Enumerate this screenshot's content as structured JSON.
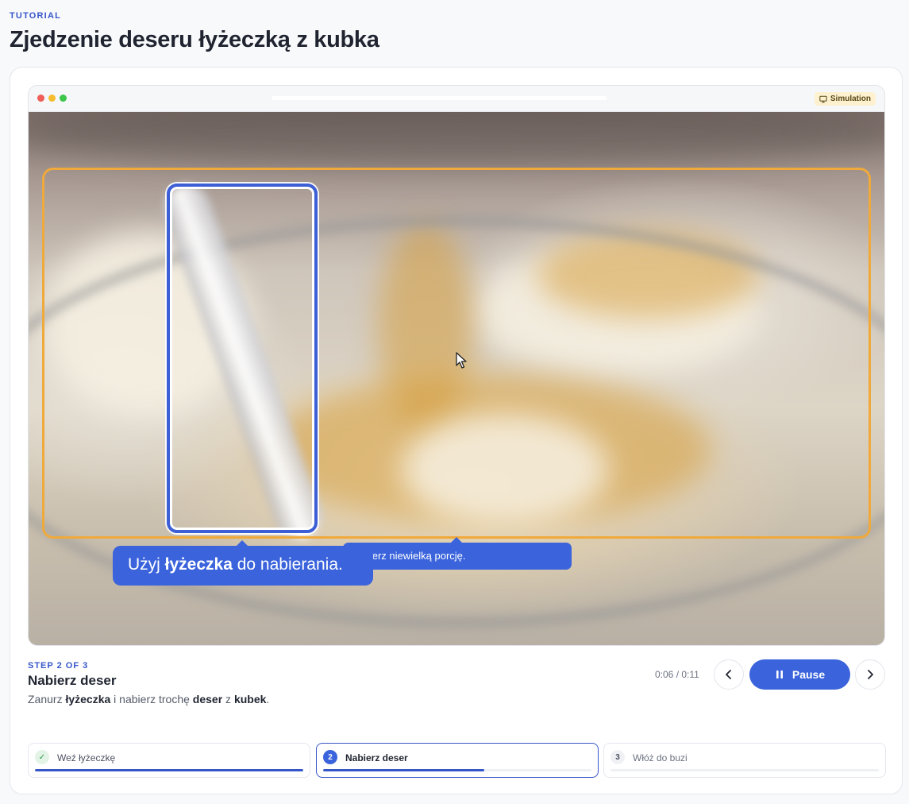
{
  "header": {
    "eyebrow": "TUTORIAL",
    "title": "Zjedzenie deseru łyżeczką z kubka"
  },
  "browser": {
    "badge_label": "Simulation",
    "badge_icon": "monitor-icon"
  },
  "overlay": {
    "tip_small": "Nabierz niewielką porcję.",
    "tip_big": {
      "prefix": "Użyj ",
      "bold": "łyżeczka",
      "suffix": " do nabierania."
    }
  },
  "step": {
    "label": "STEP 2 OF 3",
    "title": "Nabierz deser",
    "desc": {
      "t1": "Zanurz ",
      "b1": "łyżeczka",
      "t2": " i nabierz trochę ",
      "b2": "deser",
      "t3": " z ",
      "b3": "kubek",
      "t4": "."
    }
  },
  "player": {
    "timer": "0:06 / 0:11",
    "pause_label": "Pause"
  },
  "progress": [
    {
      "badge": "✓",
      "label": "Weź łyżeczkę",
      "fill": 1.0,
      "state": "done"
    },
    {
      "badge": "2",
      "label": "Nabierz deser",
      "fill": 0.6,
      "state": "active"
    },
    {
      "badge": "3",
      "label": "Włóż do buzi",
      "fill": 0.0,
      "state": "pending"
    }
  ],
  "colors": {
    "accent": "#3a63dc",
    "highlight": "#f0a93b",
    "done": "#2e9a4a"
  }
}
